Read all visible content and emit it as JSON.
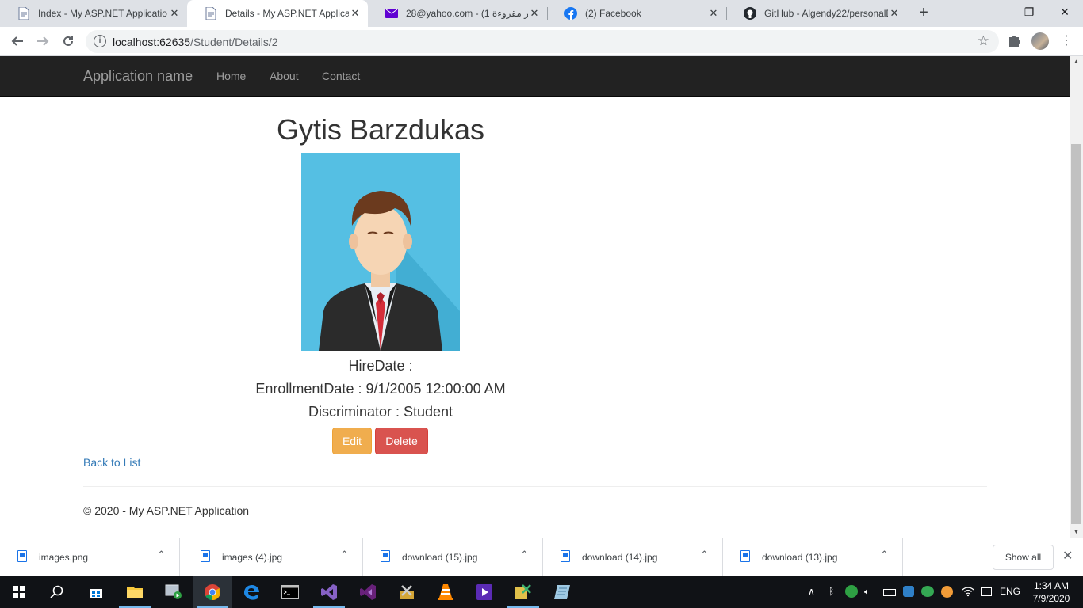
{
  "browser": {
    "tabs": [
      {
        "title": "Index - My ASP.NET Applicatio",
        "active": false
      },
      {
        "title": "Details - My ASP.NET Applicati",
        "active": true
      },
      {
        "title": "28@yahoo.com - (1 غير مقروءة)",
        "active": false
      },
      {
        "title": "(2) Facebook",
        "active": false
      },
      {
        "title": "GitHub - Algendy22/personalD",
        "active": false
      }
    ],
    "new_tab": "+",
    "close_glyph": "✕",
    "window_controls": {
      "minimize": "—",
      "maximize": "❐",
      "close": "✕"
    },
    "url": {
      "host": "localhost:62635",
      "path": "/Student/Details/2"
    }
  },
  "site": {
    "brand": "Application name",
    "nav": [
      "Home",
      "About",
      "Contact"
    ]
  },
  "details": {
    "name": "Gytis Barzdukas",
    "hire_date": "HireDate :",
    "enrollment_date": "EnrollmentDate : 9/1/2005 12:00:00 AM",
    "discriminator": "Discriminator : Student",
    "edit_label": "Edit",
    "delete_label": "Delete",
    "back_label": "Back to List",
    "footer": "© 2020 - My ASP.NET Application"
  },
  "downloads": {
    "files": [
      "images.png",
      "images (4).jpg",
      "download (15).jpg",
      "download (14).jpg",
      "download (13).jpg"
    ],
    "show_all": "Show all"
  },
  "taskbar": {
    "tray_lang": "ENG",
    "time": "1:34 AM",
    "date": "7/9/2020"
  },
  "colors": {
    "navbar": "#222222",
    "photo_bg": "#55bfe3",
    "edit": "#f0ad4e",
    "delete": "#d9534f",
    "link": "#337ab7"
  }
}
